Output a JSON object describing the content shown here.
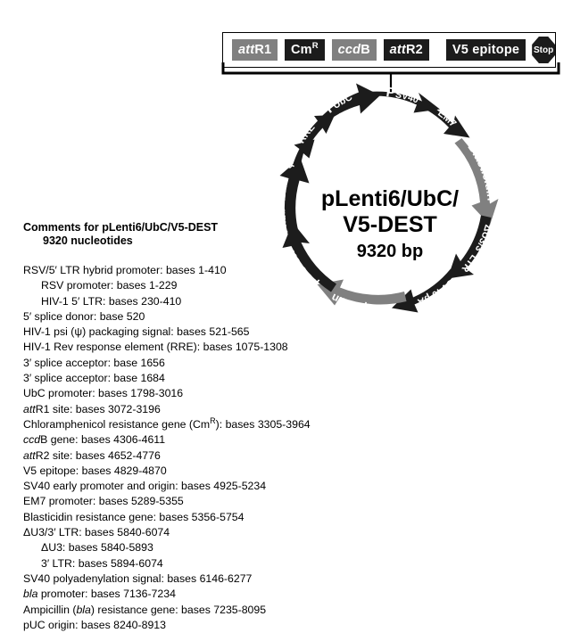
{
  "cassette": {
    "boxes": [
      {
        "name": "attR1",
        "text": "attR1",
        "italic_prefix": "att",
        "rest": "R1",
        "style": "gray"
      },
      {
        "name": "CmR",
        "text": "CmR",
        "italic_prefix": "",
        "rest": "Cm",
        "sup": "R",
        "style": "dark"
      },
      {
        "name": "ccdB",
        "text": "ccdB",
        "italic_prefix": "ccd",
        "rest": "B",
        "style": "gray"
      },
      {
        "name": "attR2",
        "text": "attR2",
        "italic_prefix": "att",
        "rest": "R2",
        "style": "dark"
      },
      {
        "name": "V5 epitope",
        "text": "V5 epitope",
        "italic_prefix": "",
        "rest": "V5 epitope",
        "style": "dark"
      }
    ],
    "stop_label": "Stop"
  },
  "map": {
    "center_line_1": "pLenti6/UbC/",
    "center_line_2": "V5-DEST",
    "center_bp": "9320 bp",
    "colors": {
      "dark": "#1c1c1c",
      "gray": "#808080",
      "text_on_arc": "#ffffff"
    },
    "features": [
      {
        "name": "P-SV40",
        "label": "PSV40",
        "base": "P",
        "sub": "SV40",
        "color": "dark",
        "direction": "clockwise"
      },
      {
        "name": "EM7",
        "label": "EM7",
        "color": "dark",
        "direction": "clockwise"
      },
      {
        "name": "Blasticidin",
        "label": "Blasticidin",
        "color": "gray",
        "direction": "clockwise"
      },
      {
        "name": "dU3-3LTR",
        "label": "ΔU3/3' LTR",
        "color": "dark",
        "direction": "clockwise"
      },
      {
        "name": "SV40-pA",
        "label": "SV40 pA",
        "color": "dark",
        "direction": "clockwise"
      },
      {
        "name": "Ampicillin",
        "label": "Ampicillin",
        "color": "gray",
        "direction": "counterclockwise"
      },
      {
        "name": "pUC-ori",
        "label": "pUC ori",
        "color": "dark",
        "direction": "counterclockwise"
      },
      {
        "name": "P-RSV-5LTR",
        "label": "PRSV/5' LTR",
        "base": "P",
        "sub": "RSV",
        "rest": "/5' LTR",
        "color": "dark",
        "direction": "clockwise"
      },
      {
        "name": "psi",
        "label": "ψ",
        "color": "dark",
        "direction": "clockwise"
      },
      {
        "name": "RRE",
        "label": "RRE",
        "color": "dark",
        "direction": "clockwise"
      },
      {
        "name": "P-UbC",
        "label": "PUbC",
        "base": "P",
        "sub": "UbC",
        "color": "dark",
        "direction": "clockwise"
      }
    ]
  },
  "comments": {
    "heading_line_1": "Comments for pLenti6/UbC/V5-DEST",
    "heading_line_2": "9320 nucleotides",
    "items": [
      {
        "text": "RSV/5′ LTR hybrid promoter: bases 1-410",
        "indent": 0
      },
      {
        "text": "RSV promoter: bases 1-229",
        "indent": 1
      },
      {
        "text": "HIV-1 5′ LTR: bases 230-410",
        "indent": 1
      },
      {
        "text": "5′ splice donor: base 520",
        "indent": 0
      },
      {
        "text": "HIV-1 psi (ψ) packaging signal: bases 521-565",
        "indent": 0
      },
      {
        "text": "HIV-1 Rev response element (RRE): bases 1075-1308",
        "indent": 0
      },
      {
        "text": "3′ splice acceptor: base 1656",
        "indent": 0
      },
      {
        "text": "3′ splice acceptor: base 1684",
        "indent": 0
      },
      {
        "text": "UbC promoter: bases 1798-3016",
        "indent": 0
      },
      {
        "text": "attR1 site: bases 3072-3196",
        "indent": 0,
        "italic": "att"
      },
      {
        "text": "Chloramphenicol resistance gene (CmR): bases 3305-3964",
        "indent": 0,
        "sup_after": "Cm"
      },
      {
        "text": "ccdB gene: bases 4306-4611",
        "indent": 0,
        "italic": "ccd"
      },
      {
        "text": "attR2 site: bases 4652-4776",
        "indent": 0,
        "italic": "att"
      },
      {
        "text": "V5 epitope: bases 4829-4870",
        "indent": 0
      },
      {
        "text": "SV40 early promoter and origin: bases 4925-5234",
        "indent": 0
      },
      {
        "text": "EM7 promoter: bases 5289-5355",
        "indent": 0
      },
      {
        "text": "Blasticidin resistance gene: bases 5356-5754",
        "indent": 0
      },
      {
        "text": "ΔU3/3′ LTR: bases 5840-6074",
        "indent": 0
      },
      {
        "text": "ΔU3: bases 5840-5893",
        "indent": 1
      },
      {
        "text": "3′ LTR: bases 5894-6074",
        "indent": 1
      },
      {
        "text": "SV40 polyadenylation signal: bases 6146-6277",
        "indent": 0
      },
      {
        "text": "bla promoter: bases 7136-7234",
        "indent": 0,
        "italic": "bla"
      },
      {
        "text": "Ampicillin (bla) resistance gene: bases 7235-8095",
        "indent": 0,
        "italic_mid": "bla"
      },
      {
        "text": "pUC origin: bases 8240-8913",
        "indent": 0
      }
    ]
  }
}
